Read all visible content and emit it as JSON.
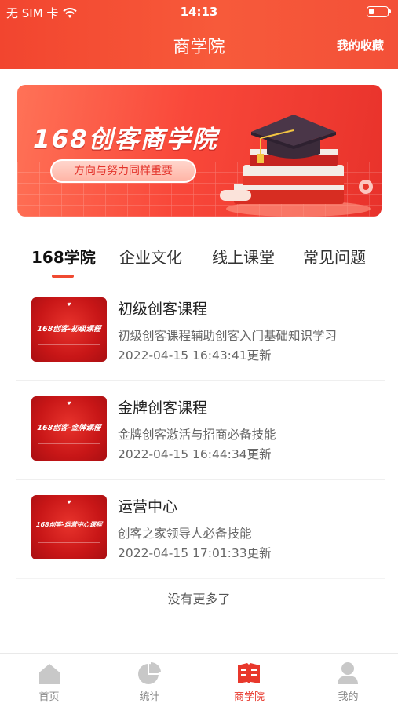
{
  "status_bar": {
    "carrier": "无 SIM 卡",
    "time": "14:13"
  },
  "header": {
    "title": "商学院",
    "favorites_label": "我的收藏"
  },
  "banner": {
    "title": "168创客商学院",
    "subtitle": "方向与努力同样重要"
  },
  "tabs": [
    {
      "label": "168学院",
      "active": true
    },
    {
      "label": "企业文化",
      "active": false
    },
    {
      "label": "线上课堂",
      "active": false
    },
    {
      "label": "常见问题",
      "active": false
    }
  ],
  "courses": [
    {
      "title": "初级创客课程",
      "description": "初级创客课程辅助创客入门基础知识学习",
      "updated": "2022-04-15 16:43:41更新",
      "thumb_text": "168创客-初级课程"
    },
    {
      "title": "金牌创客课程",
      "description": "金牌创客激活与招商必备技能",
      "updated": "2022-04-15 16:44:34更新",
      "thumb_text": "168创客-金牌课程"
    },
    {
      "title": "运营中心",
      "description": "创客之家领导人必备技能",
      "updated": "2022-04-15 17:01:33更新",
      "thumb_text": "168创客-运营中心课程"
    }
  ],
  "list_end_text": "没有更多了",
  "tabbar": [
    {
      "label": "首页",
      "icon": "home-icon",
      "active": false
    },
    {
      "label": "统计",
      "icon": "pie-chart-icon",
      "active": false
    },
    {
      "label": "商学院",
      "icon": "book-icon",
      "active": true
    },
    {
      "label": "我的",
      "icon": "user-icon",
      "active": false
    }
  ],
  "colors": {
    "brand": "#f2452f",
    "accent": "#e8382c",
    "inactive": "#c8c8c8"
  }
}
